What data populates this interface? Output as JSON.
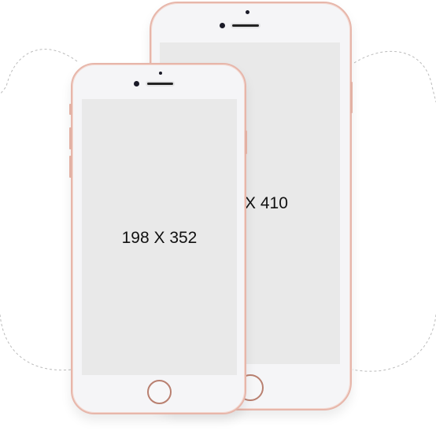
{
  "large_phone": {
    "screen_label": "X 410"
  },
  "small_phone": {
    "screen_label": "198 X 352"
  },
  "colors": {
    "frame": "#e7b6aa",
    "screen": "#e9e9e9",
    "body": "#f5f5f7"
  }
}
